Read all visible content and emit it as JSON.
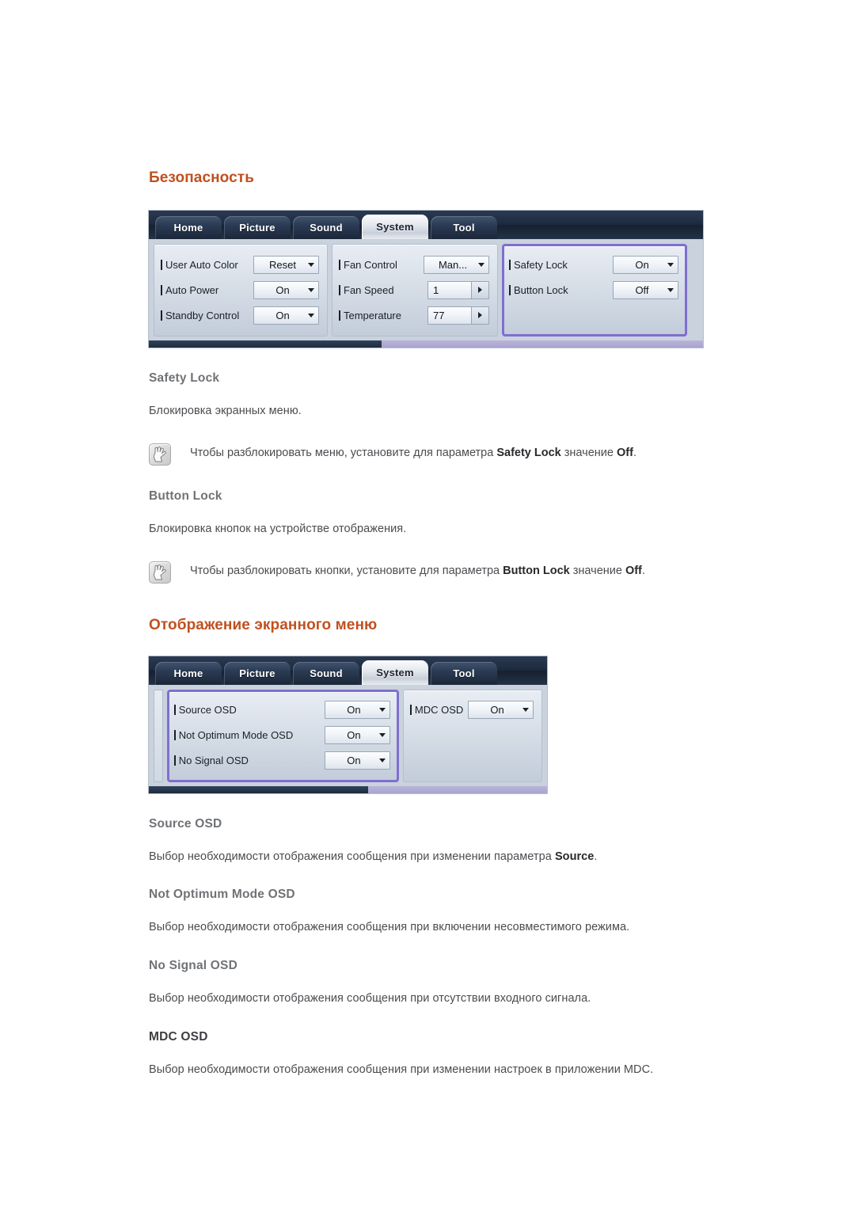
{
  "sections": [
    {
      "title": "Безопасность",
      "osd": {
        "tabs": [
          {
            "label": "Home",
            "active": false
          },
          {
            "label": "Picture",
            "active": false
          },
          {
            "label": "Sound",
            "active": false
          },
          {
            "label": "System",
            "active": true
          },
          {
            "label": "Tool",
            "active": false
          }
        ],
        "columns": [
          {
            "highlight": false,
            "rows": [
              {
                "label": "User Auto Color",
                "control": "select",
                "value": "Reset"
              },
              {
                "label": "Auto Power",
                "control": "select",
                "value": "On"
              },
              {
                "label": "Standby Control",
                "control": "select",
                "value": "On"
              }
            ]
          },
          {
            "highlight": false,
            "rows": [
              {
                "label": "Fan Control",
                "control": "select",
                "value": "Man..."
              },
              {
                "label": "Fan Speed",
                "control": "spin",
                "value": "1"
              },
              {
                "label": "Temperature",
                "control": "spin",
                "value": "77"
              }
            ]
          },
          {
            "highlight": true,
            "rows": [
              {
                "label": "Safety Lock",
                "control": "select",
                "value": "On"
              },
              {
                "label": "Button Lock",
                "control": "select",
                "value": "Off"
              }
            ]
          }
        ]
      },
      "entries": [
        {
          "heading": "Safety Lock",
          "heading_style": "gray",
          "body_parts": [
            {
              "t": "Блокировка экранных меню.",
              "b": false
            }
          ],
          "note_parts": [
            {
              "t": "Чтобы разблокировать меню, установите для параметра ",
              "b": false
            },
            {
              "t": "Safety Lock",
              "b": true
            },
            {
              "t": " значение ",
              "b": false
            },
            {
              "t": "Off",
              "b": true
            },
            {
              "t": ".",
              "b": false
            }
          ]
        },
        {
          "heading": "Button Lock",
          "heading_style": "gray",
          "body_parts": [
            {
              "t": "Блокировка кнопок на устройстве отображения.",
              "b": false
            }
          ],
          "note_parts": [
            {
              "t": "Чтобы разблокировать кнопки, установите для параметра ",
              "b": false
            },
            {
              "t": "Button Lock",
              "b": true
            },
            {
              "t": " значение ",
              "b": false
            },
            {
              "t": "Off",
              "b": true
            },
            {
              "t": ".",
              "b": false
            }
          ]
        }
      ]
    },
    {
      "title": "Отображение экранного меню",
      "osd": {
        "tabs": [
          {
            "label": "Home",
            "active": false
          },
          {
            "label": "Picture",
            "active": false
          },
          {
            "label": "Sound",
            "active": false
          },
          {
            "label": "System",
            "active": true
          },
          {
            "label": "Tool",
            "active": false
          }
        ],
        "columns": [
          {
            "highlight": true,
            "rows": [
              {
                "label": "Source OSD",
                "control": "select",
                "value": "On"
              },
              {
                "label": "Not Optimum Mode OSD",
                "control": "select",
                "value": "On"
              },
              {
                "label": "No Signal OSD",
                "control": "select",
                "value": "On"
              }
            ]
          },
          {
            "highlight": false,
            "rows": [
              {
                "label": "MDC OSD",
                "control": "select",
                "value": "On"
              }
            ]
          }
        ]
      },
      "entries": [
        {
          "heading": "Source OSD",
          "heading_style": "gray",
          "body_parts": [
            {
              "t": "Выбор необходимости отображения сообщения при изменении параметра ",
              "b": false
            },
            {
              "t": "Source",
              "b": true
            },
            {
              "t": ".",
              "b": false
            }
          ],
          "note_parts": []
        },
        {
          "heading": "Not Optimum Mode OSD",
          "heading_style": "gray",
          "body_parts": [
            {
              "t": "Выбор необходимости отображения сообщения при включении несовместимого режима.",
              "b": false
            }
          ],
          "note_parts": []
        },
        {
          "heading": "No Signal OSD",
          "heading_style": "gray",
          "body_parts": [
            {
              "t": "Выбор необходимости отображения сообщения при отсутствии входного сигнала.",
              "b": false
            }
          ],
          "note_parts": []
        },
        {
          "heading": "MDC OSD",
          "heading_style": "dark",
          "body_parts": [
            {
              "t": "Выбор необходимости отображения сообщения при изменении настроек в приложении MDC.",
              "b": false
            }
          ],
          "note_parts": []
        }
      ]
    }
  ],
  "colors": {
    "section_title": "#c1501f",
    "sub_title": "#6f7276",
    "body_text": "#4a4c50",
    "osd_highlight_border": "#7f6fcf",
    "osd_tabbar": "#1d2a3e"
  },
  "icons": {
    "note": "note-hand-icon",
    "dropdown_caret": "chevron-down-icon",
    "spinner_arrow": "chevron-right-icon"
  }
}
